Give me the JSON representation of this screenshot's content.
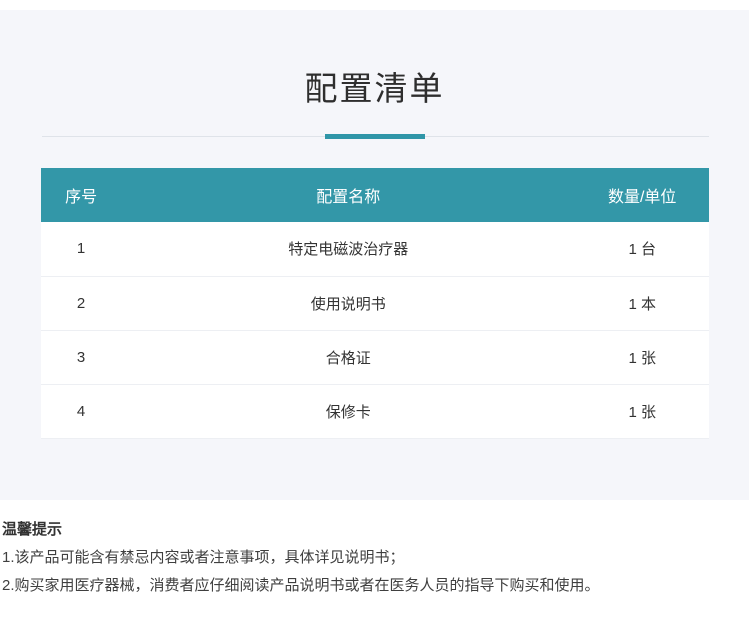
{
  "page": {
    "title": "配置清单",
    "accent_color": "#3397a8",
    "banner_background": "#f5f6fa",
    "divider_line_color": "#dfe3e9"
  },
  "table": {
    "headers": {
      "index": "序号",
      "name": "配置名称",
      "quantity": "数量/单位"
    },
    "rows": [
      {
        "index": "1",
        "name": "特定电磁波治疗器",
        "quantity": "1 台"
      },
      {
        "index": "2",
        "name": "使用说明书",
        "quantity": "1 本"
      },
      {
        "index": "3",
        "name": "合格证",
        "quantity": "1 张"
      },
      {
        "index": "4",
        "name": "保修卡",
        "quantity": "1 张"
      }
    ]
  },
  "tips": {
    "title": "温馨提示",
    "lines": [
      "1.该产品可能含有禁忌内容或者注意事项，具体详见说明书；",
      "2.购买家用医疗器械，消费者应仔细阅读产品说明书或者在医务人员的指导下购买和使用。"
    ]
  }
}
